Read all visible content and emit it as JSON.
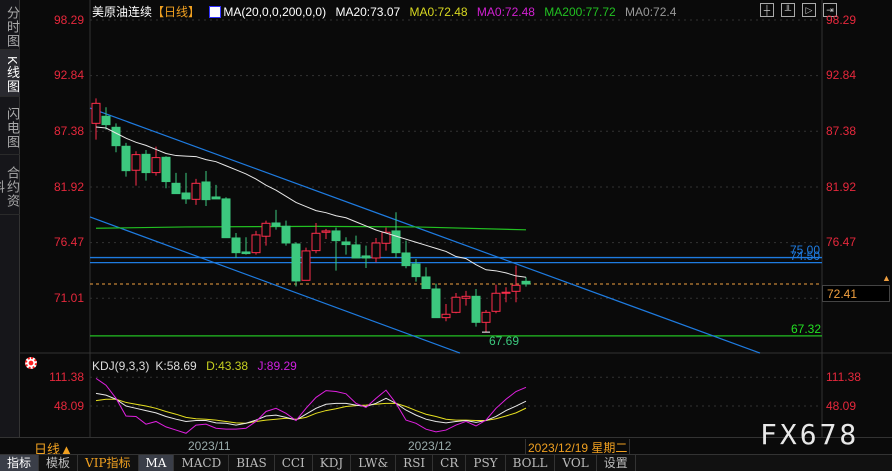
{
  "sidebar": {
    "tabs": [
      {
        "label": "分时图"
      },
      {
        "label": "K线图"
      },
      {
        "label": "闪电图"
      },
      {
        "label": "合约资料"
      }
    ]
  },
  "header": {
    "title": "美原油连续",
    "period": "【日线】",
    "ma_params": "MA(20,0,0,200,0,0)",
    "ma20": "MA20:73.07",
    "ma0a": "MA0:72.48",
    "ma0b": "MA0:72.48",
    "ma200": "MA200:77.72",
    "ma0c": "MA0:72.4",
    "icons": [
      "crosshair-icon",
      "zoom-in-icon",
      "zoom-out-icon",
      "exit-icon"
    ]
  },
  "price_axis": {
    "ticks": [
      "98.29",
      "92.84",
      "87.38",
      "81.92",
      "76.47",
      "71.01"
    ],
    "values": [
      98.29,
      92.84,
      87.38,
      81.92,
      76.47,
      71.01
    ]
  },
  "annotations": {
    "line_75": "75.00",
    "line_745": "74.50",
    "line_6732": "67.32",
    "low_label": "67.69",
    "last_price": "72.41"
  },
  "colors": {
    "up": "#ff2e4c",
    "down": "#3cc87e",
    "ma20": "#e8e8e8",
    "ma200": "#22c022",
    "trend": "#1e7be0",
    "last": "#f0a040",
    "k": "#e8e8e8",
    "d": "#e6e020",
    "j": "#e020e0",
    "axis": "#e6283c"
  },
  "candles": [
    [
      88.16,
      90.61,
      86.56,
      90.12
    ],
    [
      88.85,
      89.73,
      87.54,
      88.03
    ],
    [
      87.77,
      88.16,
      85.32,
      85.97
    ],
    [
      85.91,
      86.24,
      82.94,
      83.52
    ],
    [
      83.56,
      85.42,
      82.05,
      85.09
    ],
    [
      85.12,
      85.55,
      82.54,
      83.33
    ],
    [
      83.33,
      85.88,
      83.03,
      84.8
    ],
    [
      84.83,
      84.93,
      81.79,
      82.45
    ],
    [
      82.28,
      83.3,
      81.27,
      81.27
    ],
    [
      81.33,
      83.3,
      80.26,
      80.75
    ],
    [
      80.71,
      82.71,
      80.16,
      82.28
    ],
    [
      82.41,
      83.49,
      80.06,
      80.68
    ],
    [
      80.94,
      82.12,
      80.75,
      80.75
    ],
    [
      80.75,
      80.91,
      76.95,
      76.95
    ],
    [
      76.92,
      77.41,
      74.96,
      75.48
    ],
    [
      75.55,
      76.99,
      75.29,
      75.39
    ],
    [
      75.48,
      77.61,
      75.29,
      77.22
    ],
    [
      77.09,
      78.62,
      76.17,
      78.36
    ],
    [
      78.39,
      79.67,
      77.74,
      78.07
    ],
    [
      78.07,
      78.62,
      76.17,
      76.43
    ],
    [
      76.33,
      76.5,
      72.18,
      72.71
    ],
    [
      72.77,
      75.97,
      72.77,
      75.65
    ],
    [
      75.68,
      78.39,
      75.42,
      77.38
    ],
    [
      77.48,
      77.81,
      76.82,
      77.61
    ],
    [
      77.61,
      77.94,
      73.72,
      76.66
    ],
    [
      76.53,
      76.99,
      75.29,
      76.27
    ],
    [
      76.24,
      77.15,
      74.96,
      74.96
    ],
    [
      75.16,
      76.17,
      73.98,
      74.96
    ],
    [
      74.96,
      76.92,
      74.54,
      76.43
    ],
    [
      76.4,
      77.94,
      75.68,
      77.48
    ],
    [
      77.61,
      79.44,
      74.96,
      75.48
    ],
    [
      75.45,
      76.66,
      73.95,
      74.21
    ],
    [
      74.37,
      74.86,
      72.64,
      73.13
    ],
    [
      73.1,
      74.05,
      71.96,
      71.96
    ],
    [
      71.92,
      72.45,
      69.11,
      69.11
    ],
    [
      69.11,
      70.45,
      68.75,
      69.44
    ],
    [
      69.63,
      71.53,
      69.54,
      71.11
    ],
    [
      71.01,
      71.73,
      70.29,
      71.2
    ],
    [
      71.2,
      71.92,
      68.23,
      68.65
    ],
    [
      68.65,
      69.86,
      67.69,
      69.63
    ],
    [
      69.73,
      72.35,
      69.54,
      71.5
    ],
    [
      71.5,
      72.09,
      70.62,
      71.6
    ],
    [
      71.69,
      74.21,
      70.62,
      72.28
    ],
    [
      72.67,
      73.07,
      72.15,
      72.41
    ]
  ],
  "ma20": [
    87.8,
    87.7,
    87.2,
    86.7,
    86.3,
    86.0,
    85.6,
    85.2,
    85.0,
    84.95,
    84.9,
    84.6,
    84.4,
    84.0,
    83.6,
    83.2,
    82.7,
    82.1,
    81.6,
    81.0,
    80.4,
    80.0,
    79.6,
    79.4,
    79.1,
    78.9,
    78.5,
    78.1,
    77.7,
    77.4,
    77.1,
    76.8,
    76.5,
    76.2,
    75.9,
    75.6,
    75.1,
    74.9,
    74.3,
    73.8,
    73.7,
    73.5,
    73.2,
    73.07
  ],
  "ma200": [
    [
      0,
      77.87
    ],
    [
      9,
      78.0
    ],
    [
      22,
      78.06
    ],
    [
      32,
      78.0
    ],
    [
      43,
      77.72
    ]
  ],
  "trendlines": [
    {
      "from": [
        -0.6,
        89.66
      ],
      "to": [
        66.4,
        65.64
      ]
    },
    {
      "from": [
        -0.6,
        78.98
      ],
      "to": [
        36.4,
        65.64
      ]
    }
  ],
  "hlines": [
    75.0,
    74.5,
    67.32
  ],
  "kdj": {
    "legend": "KDJ(9,3,3)",
    "k_label": "K:58.69",
    "d_label": "D:43.38",
    "j_label": "J:89.29",
    "ticks": [
      "111.38",
      "48.09"
    ],
    "K": [
      76,
      72,
      63,
      48,
      43,
      38,
      33,
      25,
      19,
      14,
      16,
      16,
      11,
      10,
      6,
      10,
      17,
      26,
      28,
      23,
      17,
      30,
      43,
      52,
      54,
      54,
      50,
      47,
      54,
      65,
      54,
      39,
      28,
      19,
      14,
      11,
      14,
      16,
      12,
      16,
      25,
      38,
      48,
      58.69
    ],
    "D": [
      60,
      63,
      63,
      56,
      52,
      48,
      43,
      36,
      30,
      23,
      20,
      19,
      17,
      14,
      11,
      10,
      14,
      17,
      19,
      21,
      19,
      23,
      32,
      38,
      42,
      47,
      49,
      50,
      52,
      54,
      54,
      47,
      38,
      30,
      25,
      19,
      17,
      17,
      16,
      16,
      20,
      26,
      33,
      43.38
    ],
    "J": [
      109,
      94,
      65,
      26,
      25,
      8,
      14,
      2,
      -5,
      -12,
      6,
      8,
      -1,
      -3,
      -3,
      -1,
      14,
      36,
      43,
      32,
      16,
      43,
      67,
      82,
      80,
      75,
      54,
      45,
      65,
      83,
      54,
      17,
      10,
      -3,
      -9,
      -5,
      6,
      14,
      4,
      17,
      43,
      63,
      80,
      89.29
    ]
  },
  "dates": {
    "nov": "2023/11",
    "dec": "2023/12",
    "cursor": "2023/12/19 星期二",
    "period_btn": "日线▲"
  },
  "toolbar": [
    "指标",
    "模板",
    "VIP指标",
    "MA",
    "MACD",
    "BIAS",
    "CCI",
    "KDJ",
    "LW&",
    "RSI",
    "CR",
    "PSY",
    "BOLL",
    "VOL",
    "设置"
  ],
  "watermark": "FX678"
}
